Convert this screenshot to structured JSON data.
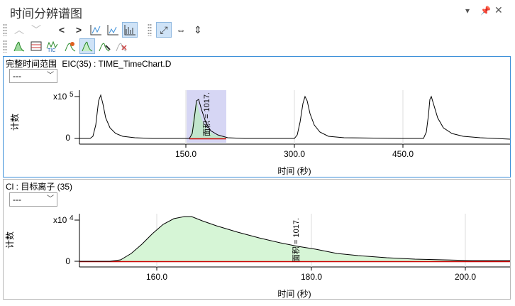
{
  "window": {
    "title": "时间分辨谱图",
    "controls": [
      "▾",
      "⊥",
      "✕"
    ]
  },
  "toolbar1": [
    "∧",
    "∨",
    "<",
    ">",
    "zoom-x-icon",
    "zoom-y-icon",
    "autoscale-icon",
    "expand-icon",
    "⇔",
    "⇕"
  ],
  "toolbar2": [
    "peak-green-icon",
    "table-icon",
    "tic-icon",
    "peak-flag-icon",
    "peak-select-icon",
    "peak-pick-icon",
    "peak-clear-icon"
  ],
  "panel1": {
    "label_range": "完整时间范围",
    "label_trace": "EIC(35) : TIME_TimeChart.D",
    "combo_value": "---",
    "y_scale": "x10",
    "y_exp": "5",
    "y_tick0": "0",
    "y_label": "计数",
    "x_label": "时间 (秒)",
    "x_ticks": [
      "150.0",
      "300.0",
      "450.0"
    ],
    "area_label": "面积 = 1017."
  },
  "panel2": {
    "label": "Cl : 目标离子 (35)",
    "combo_value": "---",
    "y_scale": "x10",
    "y_exp": "4",
    "y_tick0": "0",
    "y_label": "计数",
    "x_label": "时间 (秒)",
    "x_ticks": [
      "160.0",
      "180.0",
      "200.0"
    ],
    "area_label": "面积 = 1017."
  },
  "colors": {
    "accent": "#3c8fd8",
    "highlight": "#c8c8f0",
    "area_fill": "#d6f5d6",
    "baseline": "#cc0000"
  }
}
